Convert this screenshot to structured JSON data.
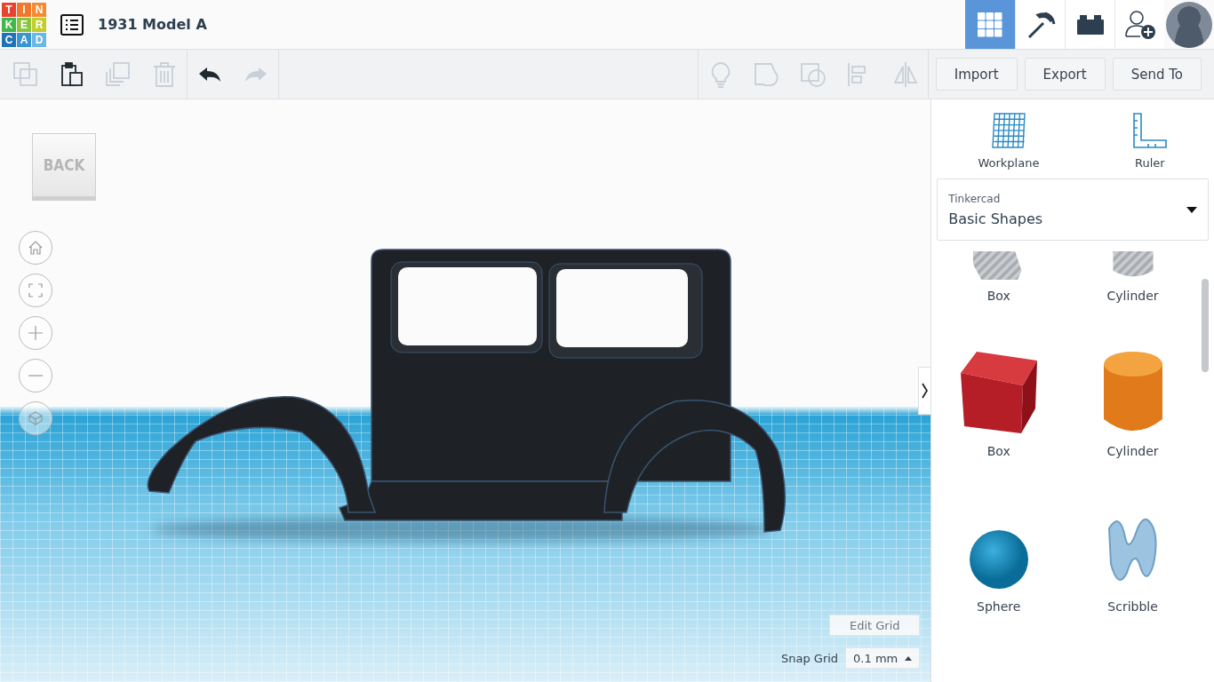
{
  "logo": [
    {
      "letter": "T",
      "color": "#e8432d"
    },
    {
      "letter": "I",
      "color": "#f0782c"
    },
    {
      "letter": "N",
      "color": "#f58a32"
    },
    {
      "letter": "K",
      "color": "#43b649"
    },
    {
      "letter": "E",
      "color": "#8bc53f"
    },
    {
      "letter": "R",
      "color": "#c3cd2e"
    },
    {
      "letter": "C",
      "color": "#1d73b8"
    },
    {
      "letter": "A",
      "color": "#3a95d3"
    },
    {
      "letter": "D",
      "color": "#6bb7e3"
    }
  ],
  "project_title": "1931 Model A",
  "view_tabs": [
    {
      "kind": "grid",
      "selected": true
    },
    {
      "kind": "pickaxe",
      "selected": false
    },
    {
      "kind": "brick",
      "selected": false
    },
    {
      "kind": "add-user",
      "selected": false
    }
  ],
  "edit_tools": [
    {
      "kind": "copy",
      "disabled": true
    },
    {
      "kind": "paste",
      "disabled": false
    },
    {
      "kind": "duplicate",
      "disabled": true
    },
    {
      "kind": "delete",
      "disabled": true
    },
    {
      "kind": "undo",
      "disabled": false
    },
    {
      "kind": "redo",
      "disabled": true
    }
  ],
  "shape_tools": [
    {
      "kind": "bulb",
      "disabled": true
    },
    {
      "kind": "group",
      "disabled": true
    },
    {
      "kind": "ungroup",
      "disabled": true
    },
    {
      "kind": "align",
      "disabled": true
    },
    {
      "kind": "mirror",
      "disabled": true
    }
  ],
  "action_buttons": [
    "Import",
    "Export",
    "Send To"
  ],
  "view_cube": {
    "label": "BACK"
  },
  "view_controls": [
    {
      "kind": "home"
    },
    {
      "kind": "fit"
    },
    {
      "kind": "zoom-in"
    },
    {
      "kind": "zoom-out"
    },
    {
      "kind": "perspective"
    }
  ],
  "edit_grid": "Edit Grid",
  "snap_grid": {
    "label": "Snap Grid",
    "value": "0.1 mm"
  },
  "sidebar": {
    "tools": [
      {
        "kind": "workplane",
        "label": "Workplane"
      },
      {
        "kind": "ruler",
        "label": "Ruler"
      }
    ],
    "library": {
      "source": "Tinkercad",
      "category": "Basic Shapes"
    },
    "shapes": [
      {
        "kind": "striped-box",
        "label": "Box"
      },
      {
        "kind": "striped-cylinder",
        "label": "Cylinder"
      },
      {
        "kind": "box",
        "label": "Box"
      },
      {
        "kind": "cylinder",
        "label": "Cylinder"
      },
      {
        "kind": "sphere",
        "label": "Sphere"
      },
      {
        "kind": "scribble",
        "label": "Scribble"
      }
    ]
  }
}
